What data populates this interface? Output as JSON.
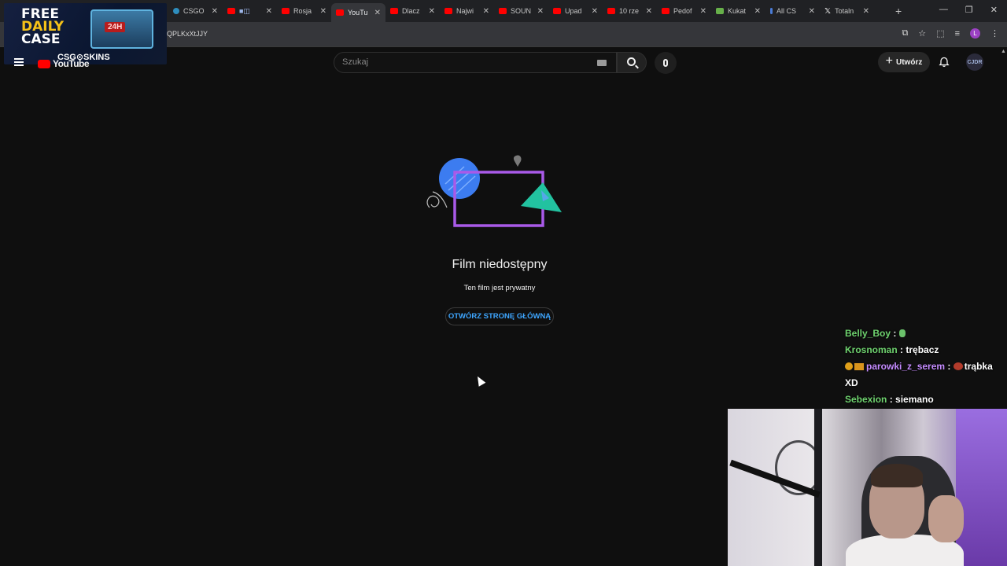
{
  "browser": {
    "tabs": [
      {
        "label": "CSGO",
        "icon": "csgo-favicon",
        "active": false
      },
      {
        "label": "",
        "icon": "youtube-favicon",
        "active": false
      },
      {
        "label": "Rosja",
        "icon": "youtube-favicon",
        "active": false
      },
      {
        "label": "YouTu",
        "icon": "youtube-favicon",
        "active": true
      },
      {
        "label": "Dlacz",
        "icon": "youtube-favicon",
        "active": false
      },
      {
        "label": "Najwi",
        "icon": "youtube-favicon",
        "active": false
      },
      {
        "label": "SOUN",
        "icon": "youtube-favicon",
        "active": false
      },
      {
        "label": "Upad",
        "icon": "youtube-favicon",
        "active": false
      },
      {
        "label": "10 rze",
        "icon": "youtube-favicon",
        "active": false
      },
      {
        "label": "Pedof",
        "icon": "youtube-favicon",
        "active": false
      },
      {
        "label": "Kukat",
        "icon": "green-favicon",
        "active": false
      },
      {
        "label": "All CS",
        "icon": "blue-favicon",
        "active": false
      },
      {
        "label": "Totaln",
        "icon": "x-favicon",
        "active": false
      }
    ],
    "new_tab": "+",
    "url": "QPLKxXtJJY",
    "profile_initial": "L"
  },
  "overlay_ad": {
    "line1": "FREE",
    "line2": "DAILY",
    "line3": "CASE",
    "chest_label": "24H",
    "brand": "CSG⊙SKINS"
  },
  "youtube": {
    "logo_text": "YouTube",
    "search_placeholder": "Szukaj",
    "create_label": "Utwórz",
    "avatar_text": "CJDR"
  },
  "error": {
    "title": "Film niedostępny",
    "subtitle": "Ten film jest prywatny",
    "home_button": "OTWÓRZ STRONĘ GŁÓWNĄ"
  },
  "chat": [
    {
      "user": "Belly_Boy",
      "sep": " : ",
      "msg": "",
      "user_color": "#6fd36f",
      "emote": "green"
    },
    {
      "user": "Krosnoman",
      "sep": " : ",
      "msg": "trębacz",
      "user_color": "#6fd36f"
    },
    {
      "user": "parowki_z_serem",
      "sep": " : ",
      "msg": "trąbka XD",
      "user_color": "#c48bff",
      "badges": true,
      "emote": "red"
    },
    {
      "user": "Sebexion",
      "sep": " : ",
      "msg": "siemano",
      "user_color": "#6fd36f"
    }
  ],
  "colors": {
    "youtube_red": "#ff0000",
    "link_blue": "#3ea6ff",
    "background": "#0f0f0f"
  }
}
